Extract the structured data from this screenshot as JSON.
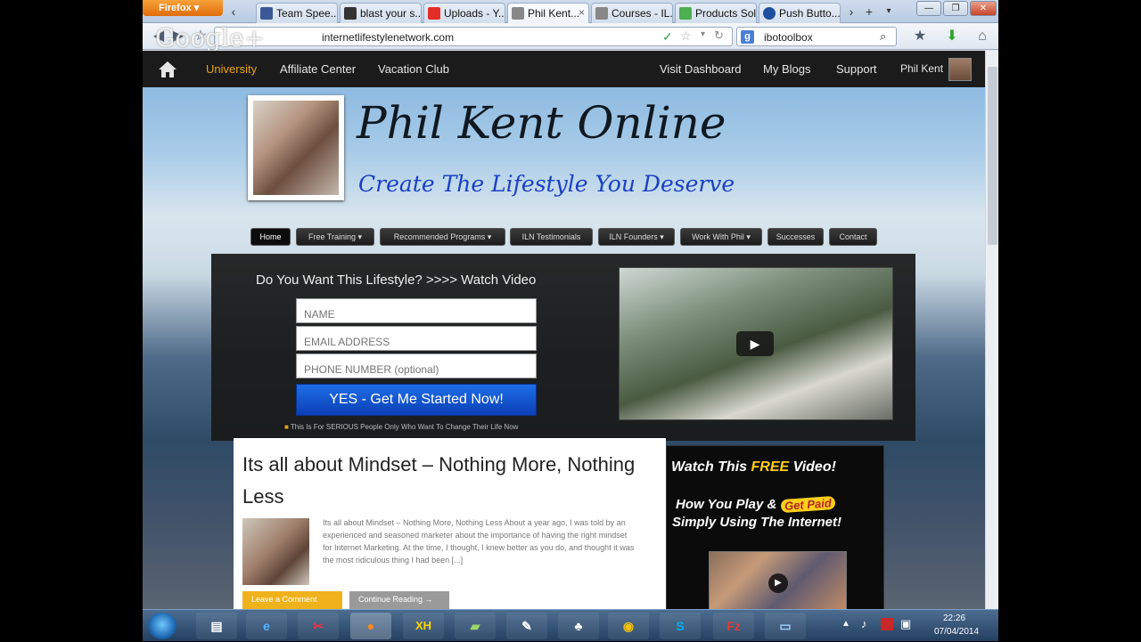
{
  "browser": {
    "app_button": "Firefox",
    "tabs": [
      {
        "label": "Team Spee...",
        "icon": "facebook-icon",
        "color": "#3b5998"
      },
      {
        "label": "blast your s...",
        "icon": "blast-icon",
        "color": "#333333"
      },
      {
        "label": "Uploads - Y...",
        "icon": "youtube-icon",
        "color": "#e52d27"
      },
      {
        "label": "Phil Kent...",
        "icon": "page-icon",
        "color": "#888888",
        "active": true
      },
      {
        "label": "Courses - IL...",
        "icon": "page-icon",
        "color": "#888888"
      },
      {
        "label": "Products Sold",
        "icon": "leaf-icon",
        "color": "#4caf50"
      },
      {
        "label": "Push Butto...",
        "icon": "target-icon",
        "color": "#1e4fa0"
      }
    ],
    "url": "internetlifestylenetwork.com",
    "google_overlay": "Google+",
    "search_engine_glyph": "g",
    "search_value": "ibotoolbox"
  },
  "site": {
    "top_nav": {
      "left": [
        "University",
        "Affiliate Center",
        "Vacation Club"
      ],
      "right": [
        "Visit Dashboard",
        "My Blogs",
        "Support",
        "Phil Kent"
      ],
      "active_color": "#e8a317"
    },
    "title": "Phil Kent Online",
    "tagline": "Create The Lifestyle You Deserve",
    "menu": [
      "Home",
      "Free Training ▾",
      "Recommended Programs ▾",
      "ILN Testimonials",
      "ILN Founders ▾",
      "Work With Phil ▾",
      "Successes",
      "Contact"
    ],
    "hero": {
      "question": "Do You Want This Lifestyle? >>>> Watch Video",
      "name_placeholder": "NAME",
      "email_placeholder": "EMAIL ADDRESS",
      "phone_placeholder": "PHONE NUMBER (optional)",
      "cta": "YES - Get Me Started Now!",
      "note": "This Is For SERIOUS People Only Who Want To Change Their Life Now"
    },
    "post": {
      "title": "Its all about Mindset – Nothing More, Nothing Less",
      "excerpt": "Its all about Mindset – Nothing More, Nothing Less About a year ago, I was told by an experienced and seasoned marketer about the importance of having the right mindset for Internet Marketing. At the time, I thought, I knew better as you do, and thought it was the most ridiculous thing I had been [...]",
      "btn_primary": "Leave a Comment",
      "btn_secondary": "Continue Reading →"
    },
    "ad": {
      "line1_a": "Watch This ",
      "line1_free": "FREE",
      "line1_b": " Video!",
      "line2": "How You Play & ",
      "line2_badge": "Get Paid",
      "line3": "Simply Using The Internet!"
    }
  },
  "taskbar": {
    "apps": [
      "explorer",
      "internet-explorer",
      "snipping-tool",
      "firefox",
      "xmind",
      "notes",
      "paint",
      "tool",
      "chrome",
      "skype",
      "filezilla",
      "notepad"
    ],
    "xmind_label": "XH",
    "skype_label": "S",
    "filezilla_label": "Fz",
    "time": "22:26",
    "date": "07/04/2014"
  }
}
